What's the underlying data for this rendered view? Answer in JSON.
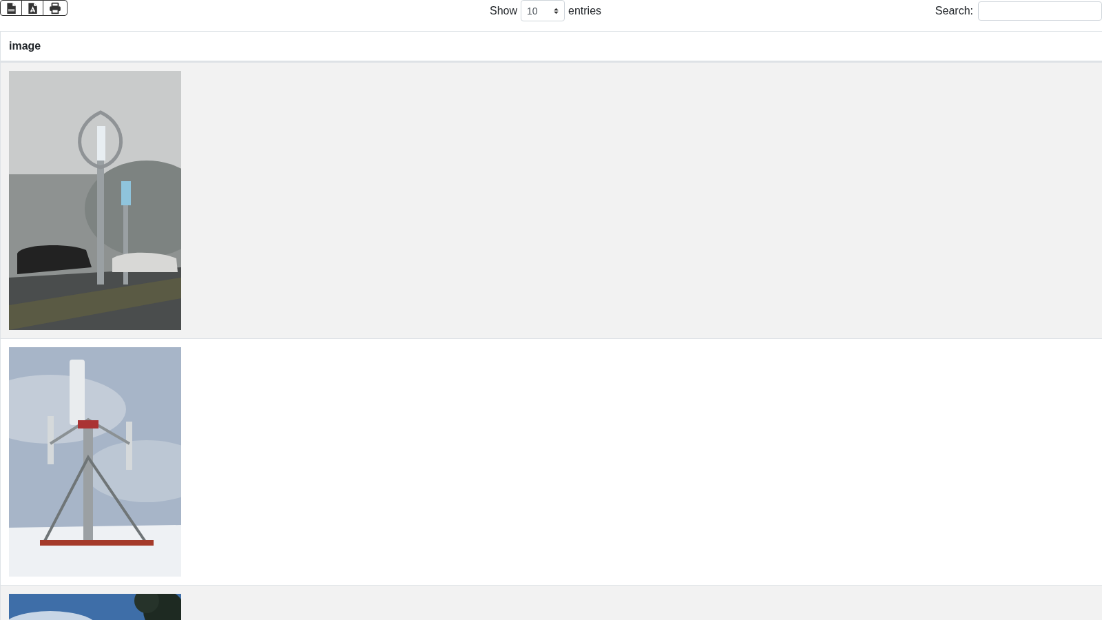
{
  "export_buttons": [
    {
      "kind": "csv"
    },
    {
      "kind": "pdf"
    },
    {
      "kind": "print"
    }
  ],
  "length": {
    "label_before": "Show",
    "value": "10",
    "label_after": "entries"
  },
  "search": {
    "label": "Search:"
  },
  "table": {
    "columns": [
      "image"
    ]
  }
}
